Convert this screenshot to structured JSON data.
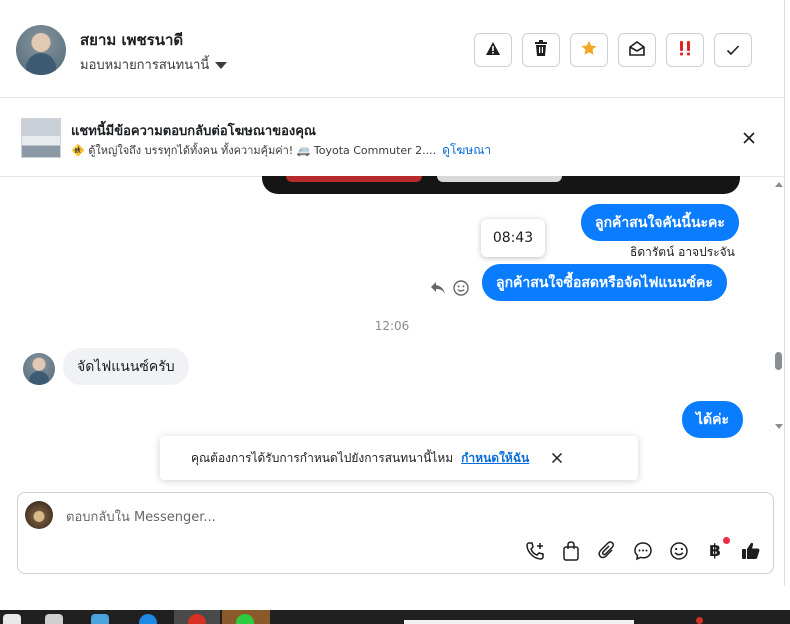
{
  "header": {
    "contact_name": "สยาม เพชรนาดี",
    "assign_label": "มอบหมายการสนทนานี้",
    "toolbar": [
      {
        "name": "alert-button",
        "icon": "warning-icon"
      },
      {
        "name": "delete-button",
        "icon": "trash-icon"
      },
      {
        "name": "star-button",
        "icon": "star-icon"
      },
      {
        "name": "mark-unread-button",
        "icon": "envelope-open-icon"
      },
      {
        "name": "follow-up-button",
        "icon": "exclamation-icon"
      },
      {
        "name": "done-button",
        "icon": "checkmark-icon"
      }
    ]
  },
  "ad_banner": {
    "title": "แชทนี้มีข้อความตอบกลับต่อโฆษณาของคุณ",
    "subtitle": "🚸 ตู้ใหญ่ใจถึง บรรทุกได้ทั้งคน ทั้งความคุ้มค่า! 🚐 Toyota Commuter 2....",
    "link": "ดูโฆษณา"
  },
  "messages": {
    "out1": "ลูกค้าสนใจคันนี้นะคะ",
    "tooltip_time": "08:43",
    "sender_name": "ธิดารัตน์ อาจประจัน",
    "out2": "ลูกค้าสนใจซื้อสดหรือจัดไฟแนนซ์คะ",
    "time_separator": "12:06",
    "in1": "จัดไฟแนนซ์ครับ",
    "out3": "ได้ค่ะ"
  },
  "reminder": {
    "text": "คุณต้องการได้รับการกำหนดไปยังการสนทนานี้ไหม",
    "link": "กำหนดให้ฉัน"
  },
  "composer": {
    "placeholder": "ตอบกลับใน Messenger...",
    "tools": [
      "call-add-icon",
      "shopping-bag-icon",
      "paperclip-icon",
      "speech-bubble-icon",
      "emoji-icon",
      "baht-icon",
      "thumbs-up-icon"
    ],
    "baht_symbol": "฿"
  },
  "colors": {
    "accent": "#0a7cff",
    "star": "#f5a623",
    "alert_red": "#e02424",
    "link": "#0a6dd8"
  }
}
